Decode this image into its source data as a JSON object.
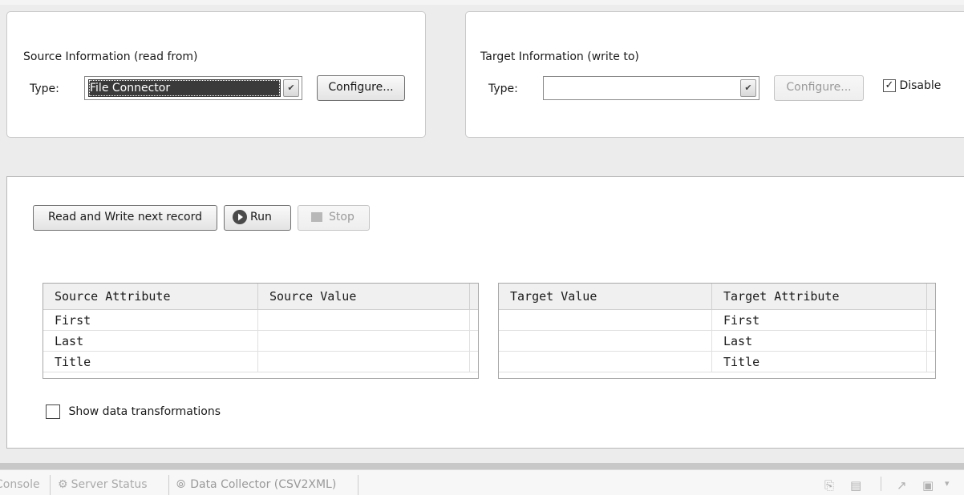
{
  "source": {
    "title": "Source Information (read from)",
    "type_label": "Type:",
    "type_value": "File Connector",
    "configure_label": "Configure..."
  },
  "target": {
    "title": "Target Information (write to)",
    "type_label": "Type:",
    "type_value": "",
    "configure_label": "Configure...",
    "disable_label": "Disable",
    "disable_checked": true
  },
  "actions": {
    "read_write_label": "Read and Write next record",
    "run_label": "Run",
    "stop_label": "Stop"
  },
  "source_table": {
    "headers": [
      "Source Attribute",
      "Source Value"
    ],
    "rows": [
      [
        "First",
        ""
      ],
      [
        "Last",
        ""
      ],
      [
        "Title",
        ""
      ]
    ]
  },
  "target_table": {
    "headers": [
      "Target Value",
      "Target Attribute"
    ],
    "rows": [
      [
        "",
        "First"
      ],
      [
        "",
        "Last"
      ],
      [
        "",
        "Title"
      ]
    ]
  },
  "show_transformations": {
    "label": "Show data transformations",
    "checked": false
  },
  "bottom_tabs": [
    "Console",
    "Server Status",
    "Data Collector (CSV2XML)"
  ],
  "icons": {
    "run": "play-circle-icon",
    "stop": "stop-square-icon",
    "combo_arrow": "chevron-down-icon"
  }
}
